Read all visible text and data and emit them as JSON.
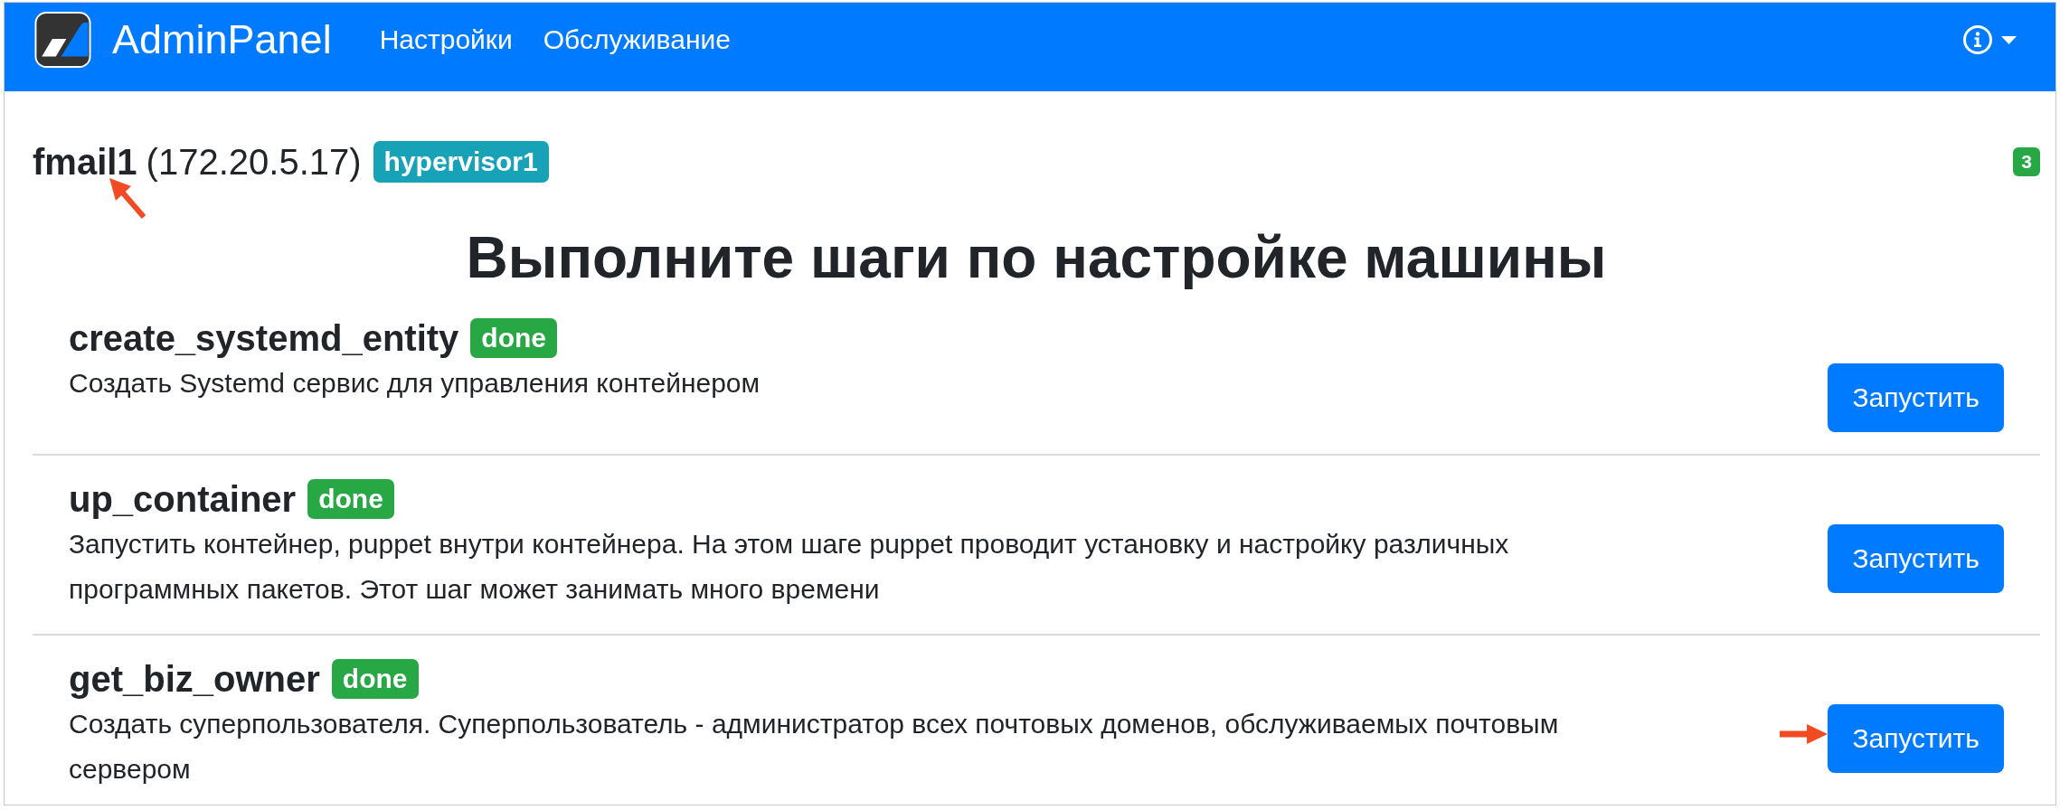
{
  "navbar": {
    "brand": "AdminPanel",
    "links": [
      "Настройки",
      "Обслуживание"
    ]
  },
  "host": {
    "name": "fmail1",
    "address": "(172.20.5.17)",
    "hypervisor": "hypervisor1",
    "pointed": true
  },
  "count": "3",
  "heading": "Выполните шаги по настройке машины",
  "steps": [
    {
      "name": "create_systemd_entity",
      "status": "done",
      "description": "Создать Systemd сервис для управления контейнером",
      "action": "Запустить",
      "pointed": false
    },
    {
      "name": "up_container",
      "status": "done",
      "description": "Запустить контейнер, puppet внутри контейнера. На этом шаге puppet проводит установку и настройку различных программных пакетов. Этот шаг может занимать много времени",
      "action": "Запустить",
      "pointed": false
    },
    {
      "name": "get_biz_owner",
      "status": "done",
      "description": "Создать суперпользователя. Суперпользователь - администратор всех почтовых доменов, обслуживаемых почтовым сервером",
      "action": "Запустить",
      "pointed": true
    }
  ]
}
